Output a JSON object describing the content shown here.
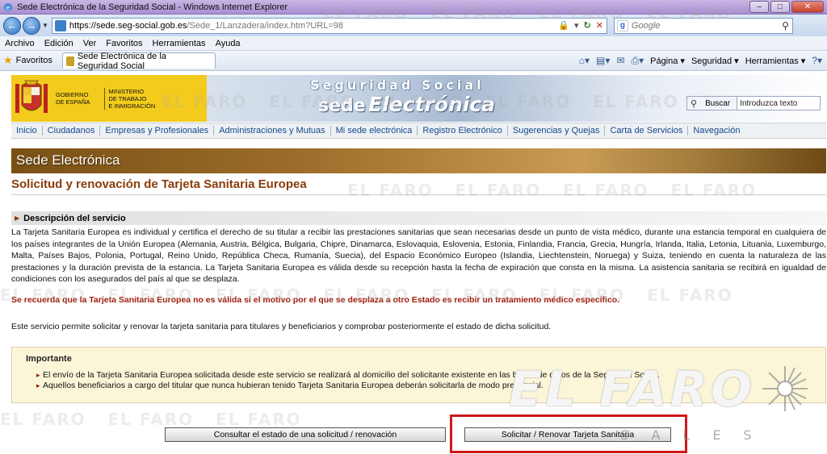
{
  "window": {
    "title": "Sede Electrónica de la Seguridad Social - Windows Internet Explorer",
    "minimize": "–",
    "maximize": "□",
    "close": "✕"
  },
  "address": {
    "url_domain": "https://sede.seg-social.gob.es",
    "url_path": "/Sede_1/Lanzadera/index.htm?URL=98",
    "search_placeholder": "Google"
  },
  "menu": [
    "Archivo",
    "Edición",
    "Ver",
    "Favoritos",
    "Herramientas",
    "Ayuda"
  ],
  "favorites": {
    "label": "Favoritos",
    "tab_title": "Sede Electrónica de la Seguridad Social",
    "commands": [
      "Página ▾",
      "Seguridad ▾",
      "Herramientas ▾"
    ]
  },
  "header": {
    "gov_line1": "GOBIERNO",
    "gov_line2": "DE ESPAÑA",
    "ministry_line1": "MINISTERIO",
    "ministry_line2": "DE TRABAJO",
    "ministry_line3": "E INMIGRACIÓN",
    "brand_top": "Seguridad Social",
    "brand_sede": "sede",
    "brand_electronica": "Electrónica",
    "search_button": "Buscar",
    "search_input_value": "Introduzca texto"
  },
  "nav": [
    "Inicio",
    "Ciudadanos",
    "Empresas y Profesionales",
    "Administraciones y Mutuas",
    "Mi sede electrónica",
    "Registro Electrónico",
    "Sugerencias y Quejas",
    "Carta de Servicios",
    "Navegación"
  ],
  "main": {
    "section_bar": "Sede Electrónica",
    "page_title": "Solicitud y renovación de Tarjeta Sanitaria Europea",
    "desc_header": "Descripción del servicio",
    "desc_body": "La Tarjeta Sanitaria Europea es individual y certifica el derecho de su titular a recibir las prestaciones sanitarias que sean necesarias desde un punto de vista médico, durante una estancia temporal en cualquiera de los países integrantes de la Unión Europea (Alemania, Austria, Bélgica, Bulgaria, Chipre, Dinamarca, Eslovaquia, Eslovenia, Estonia, Finlandia, Francia, Grecia, Hungría, Irlanda, Italia, Letonia, Lituania, Luxemburgo, Malta, Países Bajos, Polonia, Portugal, Reino Unido, República Checa, Rumanía, Suecia), del Espacio Económico Europeo (Islandia, Liechtenstein, Noruega) y Suiza, teniendo en cuenta la naturaleza de las prestaciones y la duración prevista de la estancia. La Tarjeta Sanitaria Europea es válida desde su recepción hasta la fecha de expiración que consta en la misma. La asistencia sanitaria se recibirá en igualdad de condiciones con los asegurados del país al que se desplaza.",
    "warning": "Se recuerda que la Tarjeta Sanitaria Europea no es válida si el motivo por el que se desplaza a otro Estado es recibir un tratamiento médico específico.",
    "service_note": "Este servicio permite solicitar y renovar la tarjeta sanitaria para titulares y beneficiarios y comprobar posteriormente el estado de dicha solicitud.",
    "important_title": "Importante",
    "important_items": [
      "El envío de la Tarjeta Sanitaria Europea solicitada desde este servicio se realizará al domicilio del solicitante existente en las bases de datos de la Seguridad Social.",
      "Aquellos beneficiarios a cargo del titular que nunca hubieran tenido Tarjeta Sanitaria Europea deberán solicitarla de modo presencial."
    ],
    "btn_consultar": "Consultar el estado de una solicitud / renovación",
    "btn_solicitar": "Solicitar / Renovar  Tarjeta Sanitaria"
  },
  "watermark": {
    "text": "EL FARO",
    "logo": "EL FARO",
    "sub": "SALES"
  },
  "colors": {
    "accent_red": "#d01818",
    "title_brown": "#8a3b0a",
    "gov_yellow": "#f2cb1d",
    "nav_blue": "#14478a"
  }
}
